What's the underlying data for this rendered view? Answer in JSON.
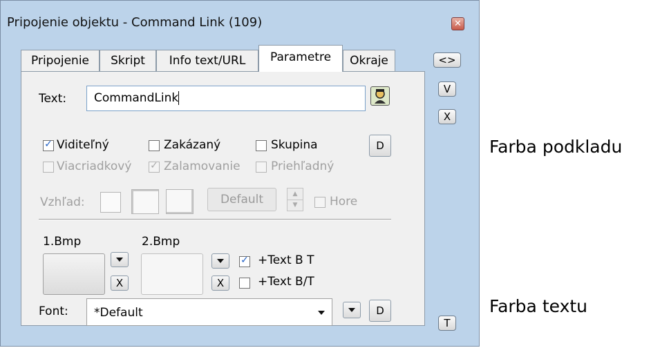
{
  "window": {
    "title": "Pripojenie objektu - Command Link (109)",
    "close_icon": "close-icon"
  },
  "tabs": [
    {
      "label": "Pripojenie",
      "active": false
    },
    {
      "label": "Skript",
      "active": false
    },
    {
      "label": "Info text/URL",
      "active": false
    },
    {
      "label": "Parametre",
      "active": true
    },
    {
      "label": "Okraje",
      "active": false
    }
  ],
  "text_field": {
    "label": "Text:",
    "value": "CommandLink"
  },
  "checkboxes": {
    "row1": [
      {
        "label": "Viditeľný",
        "checked": true,
        "enabled": true
      },
      {
        "label": "Zakázaný",
        "checked": false,
        "enabled": true
      },
      {
        "label": "Skupina",
        "checked": false,
        "enabled": true
      }
    ],
    "row2": [
      {
        "label": "Viacriadkový",
        "checked": false,
        "enabled": false
      },
      {
        "label": "Zalamovanie",
        "checked": true,
        "enabled": false
      },
      {
        "label": "Priehľadný",
        "checked": false,
        "enabled": false
      }
    ]
  },
  "d_label": "D",
  "appearance": {
    "label": "Vzhľad:",
    "value": "Default",
    "hore_label": "Hore"
  },
  "bitmaps": {
    "bmp1_label": "1.Bmp",
    "bmp2_label": "2.Bmp",
    "x_label": "X",
    "text_b_t": {
      "label": "+Text B T",
      "checked": true
    },
    "text_b_slash_t": {
      "label": "+Text B/T",
      "checked": false
    }
  },
  "font": {
    "label": "Font:",
    "value": "*Default"
  },
  "side_buttons": {
    "swap": "<>",
    "v": "V",
    "x": "X",
    "t": "T"
  },
  "annotations": {
    "background_color": "Farba podkladu",
    "text_color": "Farba textu"
  },
  "icons": {
    "person": "person-icon",
    "dropdown": "chevron-down-icon",
    "spinner": "spinner-icon"
  }
}
